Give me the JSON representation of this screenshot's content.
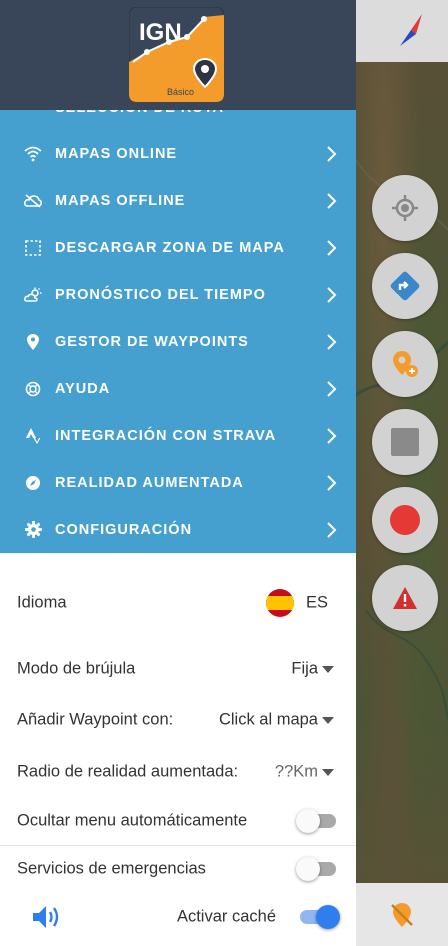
{
  "app": {
    "logo_text": "IGN",
    "logo_sub": "Básico"
  },
  "menu": {
    "partial_item": "SELECCIÓN DE RUTA",
    "items": [
      {
        "label": "MAPAS ONLINE",
        "icon": "wifi-icon"
      },
      {
        "label": "MAPAS OFFLINE",
        "icon": "cloud-off-icon"
      },
      {
        "label": "DESCARGAR ZONA DE MAPA",
        "icon": "select-area-icon"
      },
      {
        "label": "PRONÓSTICO DEL TIEMPO",
        "icon": "weather-icon"
      },
      {
        "label": "GESTOR DE WAYPOINTS",
        "icon": "map-pin-icon"
      },
      {
        "label": "AYUDA",
        "icon": "help-lifebuoy-icon"
      },
      {
        "label": "INTEGRACIÓN CON STRAVA",
        "icon": "strava-icon"
      },
      {
        "label": "REALIDAD AUMENTADA",
        "icon": "compass-icon"
      },
      {
        "label": "CONFIGURACIÓN",
        "icon": "gear-icon"
      }
    ]
  },
  "settings": {
    "language": {
      "label": "Idioma",
      "value": "ES"
    },
    "compass_mode": {
      "label": "Modo de brújula",
      "value": "Fija"
    },
    "add_waypoint": {
      "label": "Añadir Waypoint con:",
      "value": "Click al mapa"
    },
    "ar_radius": {
      "label": "Radio de realidad aumentada:",
      "value": "??Km"
    },
    "auto_hide_menu": {
      "label": "Ocultar menu automáticamente",
      "on": false
    },
    "emergency_services": {
      "label": "Servicios de emergencias",
      "on": false
    },
    "cache": {
      "label": "Activar caché",
      "on": true
    }
  },
  "colors": {
    "header_bg": "#394659",
    "menu_bg": "#45a0d0",
    "accent_orange": "#f39c2b",
    "toggle_on": "#2f7ef0",
    "record_red": "#e53935"
  }
}
